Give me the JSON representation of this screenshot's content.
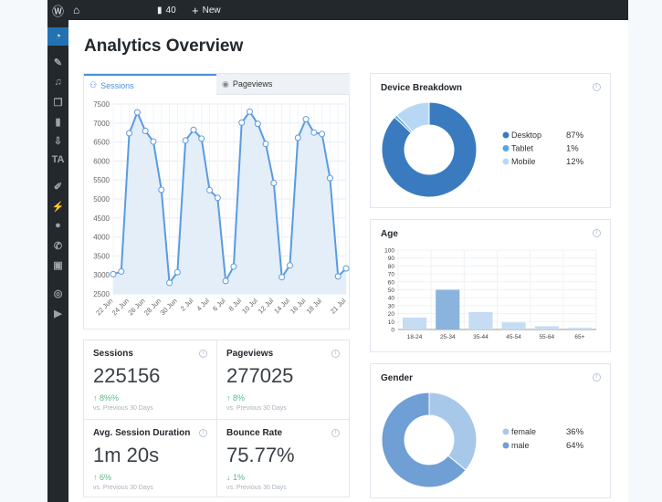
{
  "adminbar": {
    "comments_count": "40",
    "new_label": "New"
  },
  "page_title": "Analytics Overview",
  "tabs": [
    {
      "label": "Sessions",
      "active": true
    },
    {
      "label": "Pageviews",
      "active": false
    }
  ],
  "chart_data": [
    {
      "type": "area",
      "title": "",
      "ylim": [
        2500,
        7500
      ],
      "yticks": [
        2500,
        3000,
        3500,
        4000,
        4500,
        5000,
        5500,
        6000,
        6500,
        7000,
        7500
      ],
      "x": [
        "22 Jun",
        "23 Jun",
        "24 Jun",
        "25 Jun",
        "26 Jun",
        "27 Jun",
        "28 Jun",
        "29 Jun",
        "30 Jun",
        "1 Jul",
        "2 Jul",
        "3 Jul",
        "4 Jul",
        "5 Jul",
        "6 Jul",
        "7 Jul",
        "8 Jul",
        "9 Jul",
        "10 Jul",
        "11 Jul",
        "12 Jul",
        "13 Jul",
        "14 Jul",
        "15 Jul",
        "16 Jul",
        "17 Jul",
        "18 Jul",
        "19 Jul",
        "20 Jul",
        "21 Jul"
      ],
      "xtick_labels": [
        "22 Jun",
        "24 Jun",
        "26 Jun",
        "28 Jun",
        "30 Jun",
        "2 Jul",
        "4 Jul",
        "6 Jul",
        "8 Jul",
        "10 Jul",
        "12 Jul",
        "14 Jul",
        "16 Jul",
        "18 Jul",
        "21 Jul"
      ],
      "values": [
        3020,
        3090,
        6730,
        7280,
        6790,
        6510,
        5240,
        2790,
        3070,
        6540,
        6820,
        6590,
        5230,
        5030,
        2840,
        3220,
        7010,
        7300,
        6980,
        6450,
        5420,
        2940,
        3250,
        6610,
        7100,
        6750,
        6710,
        5550,
        2960,
        3170
      ],
      "color": "#5b9be0",
      "grid": true
    },
    {
      "type": "pie",
      "title": "Device Breakdown",
      "categories": [
        "Desktop",
        "Tablet",
        "Mobile"
      ],
      "values": [
        87,
        1,
        12
      ],
      "labels": [
        "87%",
        "1%",
        "12%"
      ],
      "colors": [
        "#3a7bc0",
        "#5aa5e6",
        "#b7d8f5"
      ]
    },
    {
      "type": "bar",
      "title": "Age",
      "categories": [
        "18-24",
        "25-34",
        "35-44",
        "45-54",
        "55-64",
        "65+"
      ],
      "values": [
        15,
        50,
        22,
        9,
        4,
        2
      ],
      "ylim": [
        0,
        100
      ],
      "yticks": [
        0,
        10,
        20,
        30,
        40,
        50,
        60,
        70,
        80,
        90,
        100
      ],
      "colors": [
        "#c5dcf2",
        "#8ab4de",
        "#c5dcf2",
        "#c5dcf2",
        "#c5dcf2",
        "#c5dcf2"
      ],
      "grid": true
    },
    {
      "type": "pie",
      "title": "Gender",
      "categories": [
        "female",
        "male"
      ],
      "values": [
        36,
        64
      ],
      "labels": [
        "36%",
        "64%"
      ],
      "colors": [
        "#a8c8ea",
        "#6f9fd4"
      ]
    }
  ],
  "stats": [
    {
      "label": "Sessions",
      "value": "225156",
      "change": "8%%",
      "direction": "up",
      "vs": "vs. Previous 30 Days"
    },
    {
      "label": "Pageviews",
      "value": "277025",
      "change": "8%",
      "direction": "up",
      "vs": "vs. Previous 30 Days"
    },
    {
      "label": "Avg. Session Duration",
      "value": "1m 20s",
      "change": "6%",
      "direction": "up",
      "vs": "vs. Previous 30 Days"
    },
    {
      "label": "Bounce Rate",
      "value": "75.77%",
      "change": "1%",
      "direction": "down",
      "vs": "vs. Previous 30 Days"
    }
  ]
}
